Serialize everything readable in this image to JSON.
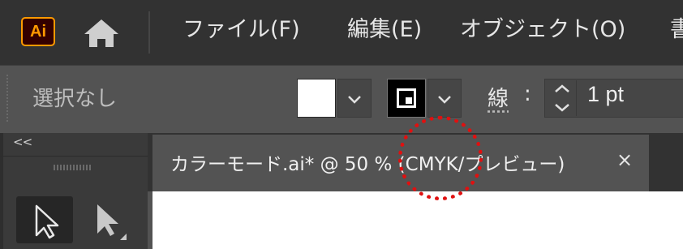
{
  "app": {
    "logo_text": "Ai",
    "accent": "#ff9a00"
  },
  "menu": {
    "items": [
      "ファイル(F)",
      "編集(E)",
      "オブジェクト(O)",
      "書"
    ]
  },
  "control_bar": {
    "selection_label": "選択なし",
    "stroke_label": "線",
    "stroke_colon": ":",
    "stroke_weight": "1 pt"
  },
  "tool_panel": {
    "collapse_label": "<<"
  },
  "document_tab": {
    "title": "カラーモード.ai* @ 50 % (CMYK/プレビュー)",
    "close_label": "×"
  },
  "icons": {
    "home": "home-icon",
    "chevron": "chevron-down-icon",
    "stepper": "stepper-icon",
    "selection_tool": "selection-tool-icon",
    "direct_selection_tool": "direct-selection-tool-icon"
  },
  "highlight_color": "#e01010"
}
